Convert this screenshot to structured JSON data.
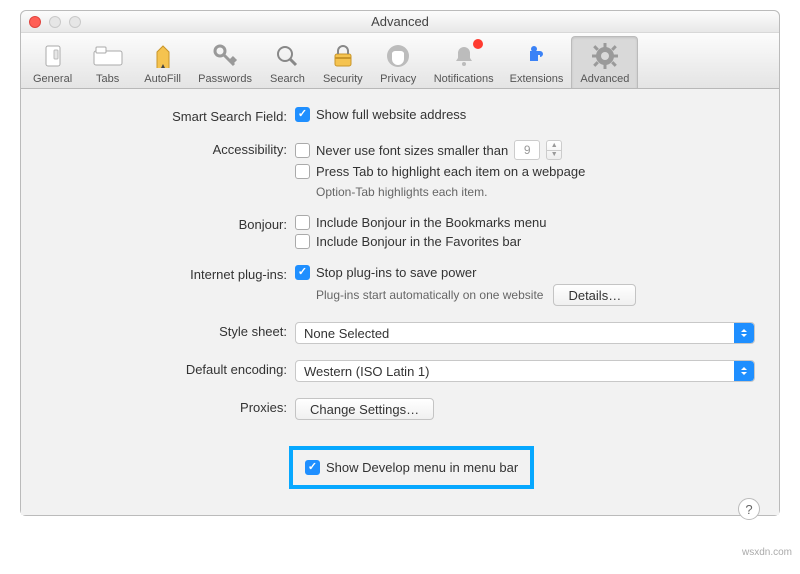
{
  "window": {
    "title": "Advanced"
  },
  "toolbar": {
    "items": [
      {
        "label": "General"
      },
      {
        "label": "Tabs"
      },
      {
        "label": "AutoFill"
      },
      {
        "label": "Passwords"
      },
      {
        "label": "Search"
      },
      {
        "label": "Security"
      },
      {
        "label": "Privacy"
      },
      {
        "label": "Notifications"
      },
      {
        "label": "Extensions"
      },
      {
        "label": "Advanced"
      }
    ]
  },
  "sections": {
    "smartSearch": {
      "label": "Smart Search Field:",
      "opt": "Show full website address"
    },
    "accessibility": {
      "label": "Accessibility:",
      "opt1": "Never use font sizes smaller than",
      "fontSize": "9",
      "opt2": "Press Tab to highlight each item on a webpage",
      "hint": "Option-Tab highlights each item."
    },
    "bonjour": {
      "label": "Bonjour:",
      "opt1": "Include Bonjour in the Bookmarks menu",
      "opt2": "Include Bonjour in the Favorites bar"
    },
    "plugins": {
      "label": "Internet plug-ins:",
      "opt": "Stop plug-ins to save power",
      "hint": "Plug-ins start automatically on one website",
      "detailsBtn": "Details…"
    },
    "styleSheet": {
      "label": "Style sheet:",
      "value": "None Selected"
    },
    "encoding": {
      "label": "Default encoding:",
      "value": "Western (ISO Latin 1)"
    },
    "proxies": {
      "label": "Proxies:",
      "btn": "Change Settings…"
    },
    "develop": {
      "opt": "Show Develop menu in menu bar"
    }
  },
  "watermark": "wsxdn.com"
}
